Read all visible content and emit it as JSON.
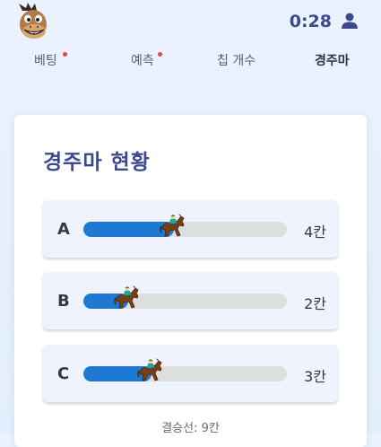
{
  "header": {
    "logo_icon": "horse-mascot-icon",
    "timer": "0:28",
    "user_icon": "user-icon"
  },
  "nav": {
    "items": [
      {
        "label": "베팅",
        "has_dot": true,
        "active": false
      },
      {
        "label": "예측",
        "has_dot": true,
        "active": false
      },
      {
        "label": "칩 개수",
        "has_dot": false,
        "active": false
      },
      {
        "label": "경주마",
        "has_dot": false,
        "active": true
      }
    ]
  },
  "race": {
    "title": "경주마 현황",
    "finish_line": "결승선: 9칸",
    "finish_cells": 9,
    "accent_color": "#1f78d1",
    "lanes": [
      {
        "label": "A",
        "cells_text": "4칸",
        "cells": 4
      },
      {
        "label": "B",
        "cells_text": "2칸",
        "cells": 2
      },
      {
        "label": "C",
        "cells_text": "3칸",
        "cells": 3
      }
    ]
  }
}
